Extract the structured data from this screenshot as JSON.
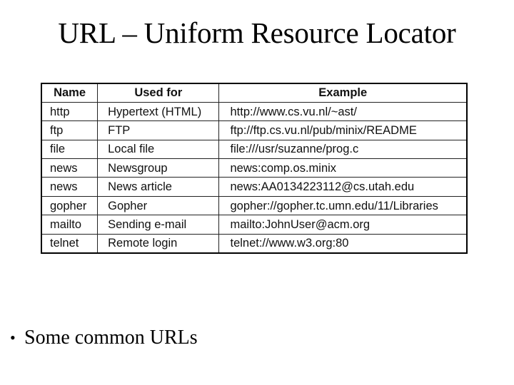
{
  "slide": {
    "title": "URL – Uniform Resource Locator"
  },
  "table": {
    "headers": [
      "Name",
      "Used for",
      "Example"
    ],
    "rows": [
      [
        "http",
        "Hypertext (HTML)",
        "http://www.cs.vu.nl/~ast/"
      ],
      [
        "ftp",
        "FTP",
        "ftp://ftp.cs.vu.nl/pub/minix/README"
      ],
      [
        "file",
        "Local file",
        "file:///usr/suzanne/prog.c"
      ],
      [
        "news",
        "Newsgroup",
        "news:comp.os.minix"
      ],
      [
        "news",
        "News article",
        "news:AA0134223112@cs.utah.edu"
      ],
      [
        "gopher",
        "Gopher",
        "gopher://gopher.tc.umn.edu/11/Libraries"
      ],
      [
        "mailto",
        "Sending e-mail",
        "mailto:JohnUser@acm.org"
      ],
      [
        "telnet",
        "Remote login",
        "telnet://www.w3.org:80"
      ]
    ]
  },
  "bullets": [
    {
      "icon": "bullet-dot-icon",
      "glyph": "•",
      "text": "Some common URLs"
    }
  ]
}
